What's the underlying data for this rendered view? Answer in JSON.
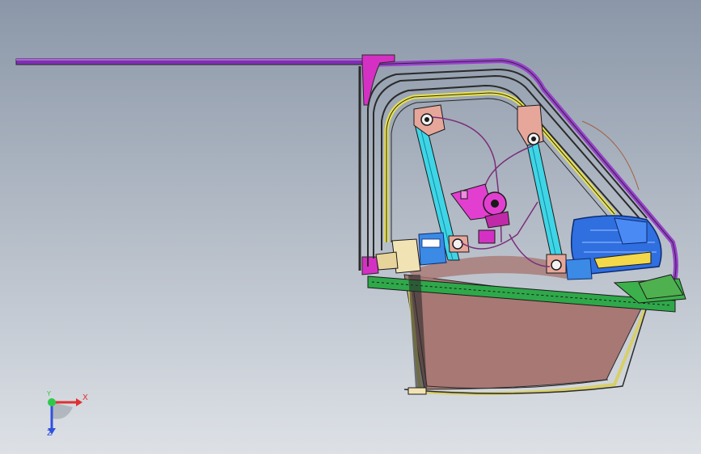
{
  "viewport": {
    "background_top": "#8b97a8",
    "background_bottom": "#dde1e6"
  },
  "model": {
    "colors": {
      "top_rail": "#9a3fd0",
      "frame_outline": "#2a2a2a",
      "frame_inner_yellow": "#e9e24a",
      "window_glass": "#a87874",
      "glass_edge": "#d9cf6a",
      "lift_rail": "#3fd5e6",
      "motor": "#e23fd0",
      "bracket_pink": "#e6a79a",
      "latch_blue": "#2f6fe0",
      "seal_green": "#2fa84a",
      "cable": "#7a2f7a",
      "hinge_block": "#f2e3b4"
    }
  },
  "triad": {
    "x_label": "X",
    "y_label": "Y",
    "z_label": "Z",
    "x_color": "#e03030",
    "y_color": "#2ec94a",
    "z_color": "#3050e0"
  }
}
